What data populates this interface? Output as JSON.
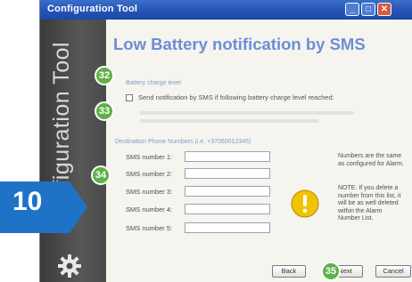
{
  "window": {
    "title": "Configuration Tool"
  },
  "sidebar": {
    "label": "Configuration Tool"
  },
  "page": {
    "heading": "Low Battery notification by SMS"
  },
  "battery": {
    "section_label": "Battery charge level",
    "checkbox_label": "Send notification by SMS if following battery charge level reached:",
    "checked": false
  },
  "destination": {
    "section_label": "Destination Phone Numbers (i.e. +37060012345)",
    "fields": [
      {
        "label": "SMS number 1:",
        "value": ""
      },
      {
        "label": "SMS number 2:",
        "value": ""
      },
      {
        "label": "SMS number 3:",
        "value": ""
      },
      {
        "label": "SMS number 4:",
        "value": ""
      },
      {
        "label": "SMS number 5:",
        "value": ""
      }
    ]
  },
  "notes": {
    "same_as_alarm": "Numbers are the same as configured for Alarm.",
    "delete_note": "NOTE:  If you delete a number from this list, it will be as well deleted within the Alarm Number List."
  },
  "buttons": {
    "back": "Back",
    "next": "Next",
    "cancel": "Cancel"
  },
  "callouts": {
    "c32": "32",
    "c33": "33",
    "c34": "34",
    "c35": "35",
    "step": "10"
  },
  "colors": {
    "accent": "#6b8ed6",
    "badge": "#5fb04a",
    "step_arrow": "#1f73c7"
  },
  "icons": {
    "warning": "warning-icon",
    "gear": "gear-icon"
  }
}
